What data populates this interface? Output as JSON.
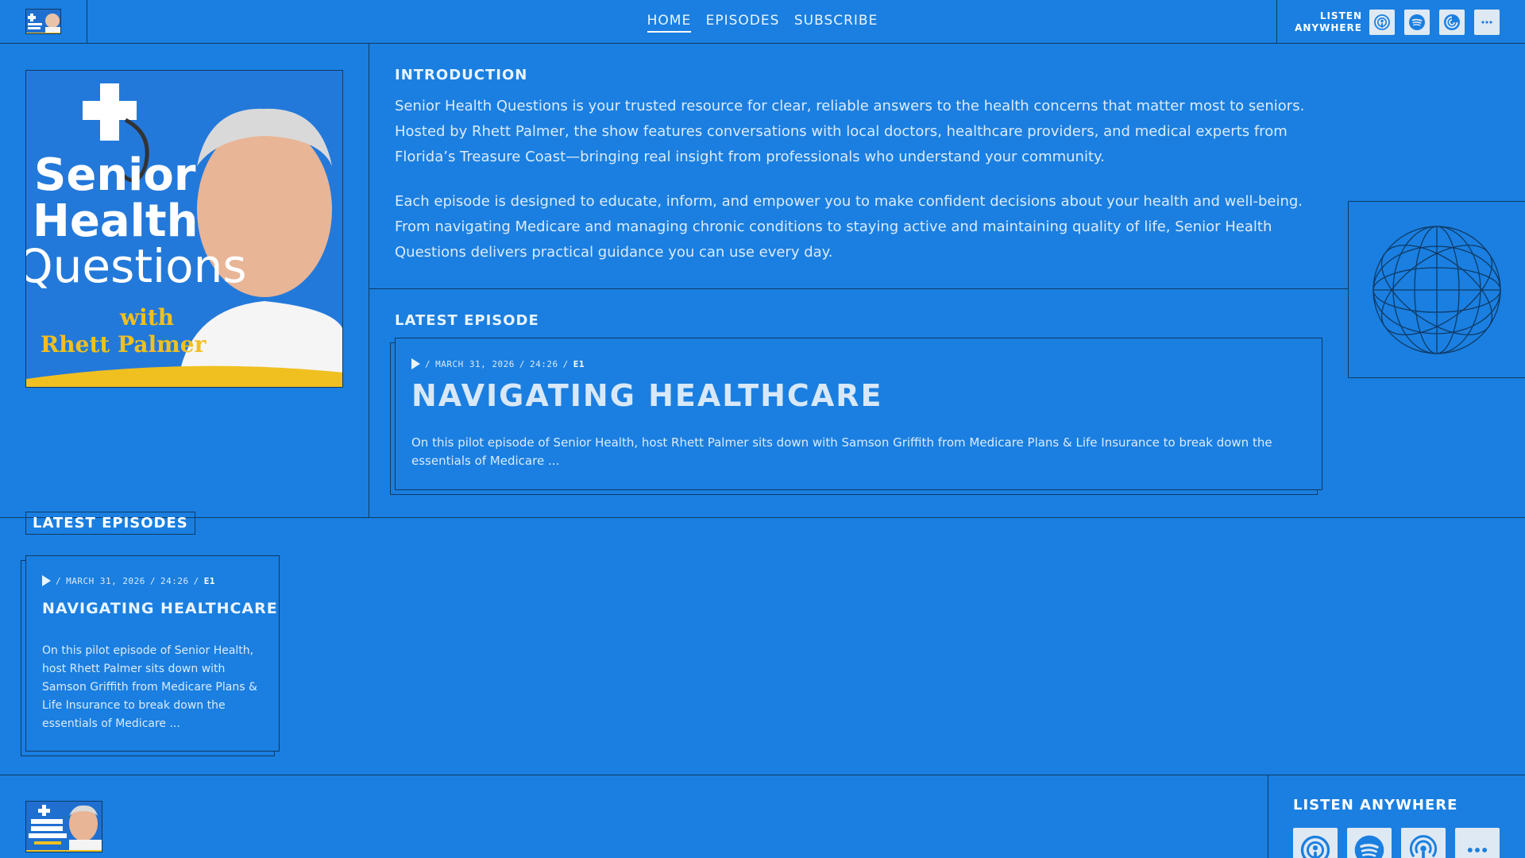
{
  "header": {
    "nav": [
      {
        "label": "HOME",
        "active": true
      },
      {
        "label": "EPISODES",
        "active": false
      },
      {
        "label": "SUBSCRIBE",
        "active": false
      }
    ],
    "listen_label_line1": "LISTEN",
    "listen_label_line2": "ANYWHERE",
    "platform_icons": [
      "apple-podcasts-icon",
      "spotify-icon",
      "pocket-casts-icon",
      "more-icon"
    ]
  },
  "cover": {
    "line1": "Senior",
    "line2": "Health",
    "line3": "Questions",
    "line4": "with",
    "line5": "Rhett Palmer"
  },
  "introduction": {
    "title": "INTRODUCTION",
    "paragraph1": "Senior Health Questions is your trusted resource for clear, reliable answers to the health concerns that matter most to seniors. Hosted by Rhett Palmer, the show features conversations with local doctors, healthcare providers, and medical experts from Florida’s Treasure Coast—bringing real insight from professionals who understand your community.",
    "paragraph2": "Each episode is designed to educate, inform, and empower you to make confident decisions about your health and well-being. From navigating Medicare and managing chronic conditions to staying active and maintaining quality of life, Senior Health Questions delivers practical guidance you can use every day."
  },
  "latest_episode": {
    "title": "LATEST EPISODE",
    "date": "MARCH 31, 2026",
    "duration": "24:26",
    "number": "E1",
    "heading": "NAVIGATING HEALTHCARE",
    "description": "On this pilot episode of Senior Health, host Rhett Palmer sits down with Samson Griffith from Medicare Plans & Life Insurance to break down the essentials of Medicare ..."
  },
  "latest_episodes": {
    "label": "LATEST EPISODES",
    "items": [
      {
        "date": "MARCH 31, 2026",
        "duration": "24:26",
        "number": "E1",
        "heading": "NAVIGATING HEALTHCARE",
        "description": "On this pilot episode of Senior Health, host Rhett Palmer sits down with Samson Griffith from Medicare Plans & Life Insurance to break down the essentials of Medicare ..."
      }
    ]
  },
  "footer": {
    "listen_title": "LISTEN ANYWHERE"
  },
  "colors": {
    "background": "#1a7fe0",
    "border": "#0e3a66",
    "text": "#ffffff",
    "icon_tile": "#dfe9f3",
    "cover_yellow": "#f0c020"
  }
}
